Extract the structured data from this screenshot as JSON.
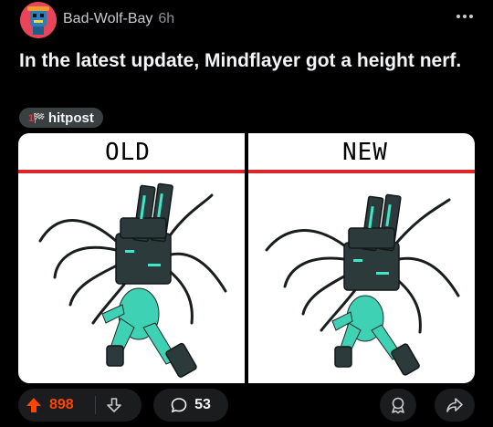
{
  "post": {
    "username": "Bad-Wolf-Bay",
    "age": "6h",
    "title": "In the latest update, Mindflayer got a height nerf.",
    "flair": {
      "emoji": "1🏁",
      "label": "hitpost"
    }
  },
  "image": {
    "left_label": "OLD",
    "right_label": "NEW"
  },
  "actions": {
    "score": "898",
    "comments": "53",
    "icons": [
      "upvote-arrow-icon",
      "downvote-arrow-icon",
      "comment-bubble-icon",
      "award-icon",
      "share-arrow-icon",
      "more-dots-icon"
    ]
  },
  "colors": {
    "background": "#000000",
    "accent_upvote": "#ff4500",
    "flair_bg": "#3a3f42",
    "pill_bg": "#1a1c1d",
    "red_rule": "#d9262a",
    "figure_teal": "#3fd1b4",
    "figure_armor": "#2c3a3c"
  }
}
